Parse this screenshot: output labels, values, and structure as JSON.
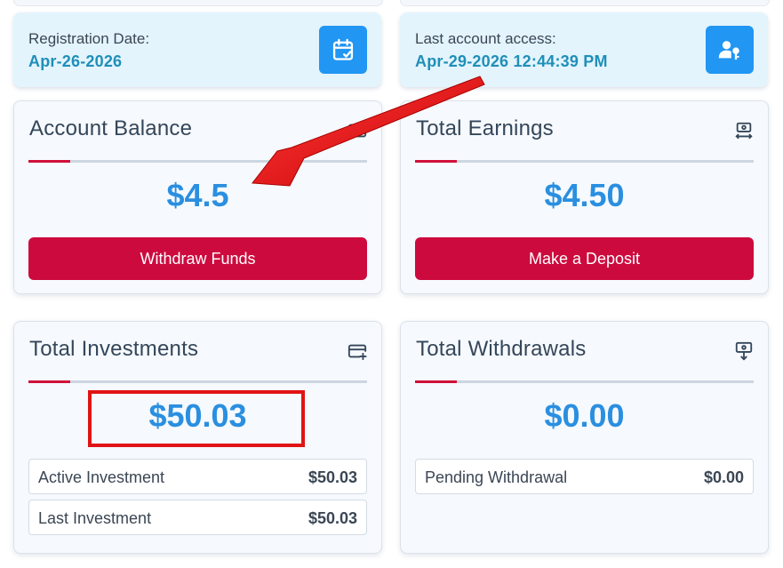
{
  "registration": {
    "label": "Registration Date:",
    "value": "Apr-26-2026"
  },
  "last_access": {
    "label": "Last account access:",
    "value": "Apr-29-2026 12:44:39 PM"
  },
  "account_balance": {
    "title": "Account Balance",
    "amount": "$4.5",
    "button_label": "Withdraw Funds"
  },
  "total_earnings": {
    "title": "Total Earnings",
    "amount": "$4.50",
    "button_label": "Make a Deposit"
  },
  "total_investments": {
    "title": "Total Investments",
    "amount": "$50.03",
    "rows": [
      {
        "label": "Active Investment",
        "value": "$50.03"
      },
      {
        "label": "Last Investment",
        "value": "$50.03"
      }
    ]
  },
  "total_withdrawals": {
    "title": "Total Withdrawals",
    "amount": "$0.00",
    "rows": [
      {
        "label": "Pending Withdrawal",
        "value": "$0.00"
      }
    ]
  },
  "colors": {
    "accent_blue": "#2196f3",
    "amount_blue": "#2a8fe0",
    "button_red": "#cd0a3e",
    "divider_accent": "#d0103a",
    "annotation_red": "#e01414"
  },
  "icons": {
    "registration": "calendar-check-icon",
    "last_access": "user-key-icon",
    "account_balance": "card-icon",
    "total_earnings": "money-exchange-icon",
    "total_investments": "card-plus-icon",
    "total_withdrawals": "money-down-icon"
  }
}
